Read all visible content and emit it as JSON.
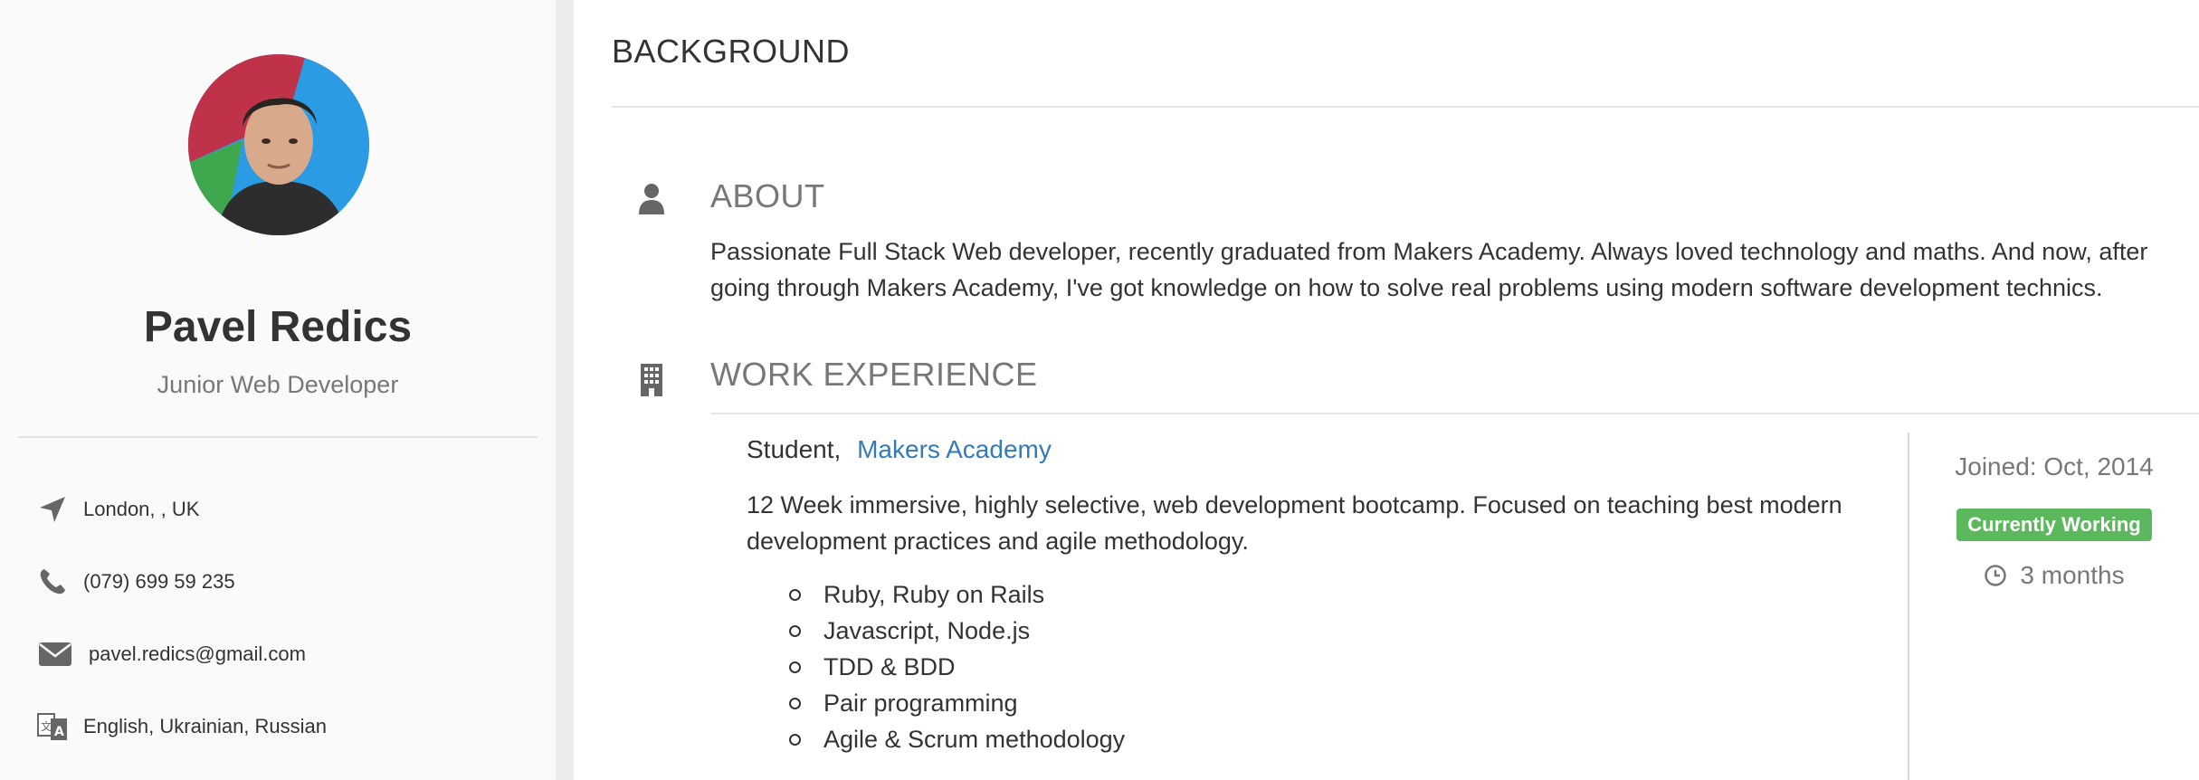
{
  "profile": {
    "name": "Pavel Redics",
    "title": "Junior Web Developer"
  },
  "contacts": [
    {
      "icon": "location-arrow-icon",
      "text": "London, , UK"
    },
    {
      "icon": "phone-icon",
      "text": "(079) 699 59 235"
    },
    {
      "icon": "envelope-icon",
      "text": "pavel.redics@gmail.com"
    },
    {
      "icon": "language-icon",
      "text": "English, Ukrainian, Russian"
    }
  ],
  "background": {
    "title": "BACKGROUND",
    "about": {
      "title": "ABOUT",
      "text": "Passionate Full Stack Web developer, recently graduated from Makers Academy. Always loved technology and maths. And now, after going through Makers Academy, I've got knowledge on how to solve real problems using modern software development technics."
    },
    "work": {
      "title": "WORK EXPERIENCE",
      "jobs": [
        {
          "position": "Student,",
          "company": "Makers Academy",
          "description": "12 Week immersive, highly selective, web development bootcamp. Focused on teaching best modern development practices and agile methodology.",
          "items": [
            "Ruby, Ruby on Rails",
            "Javascript, Node.js",
            "TDD & BDD",
            "Pair programming",
            "Agile & Scrum methodology"
          ],
          "joined_label": "Joined:",
          "joined_date": "Oct, 2014",
          "status": "Currently Working",
          "duration": "3 months"
        }
      ]
    }
  },
  "colors": {
    "link": "#337ab7",
    "badge": "#5cb85c",
    "muted": "#777777"
  }
}
